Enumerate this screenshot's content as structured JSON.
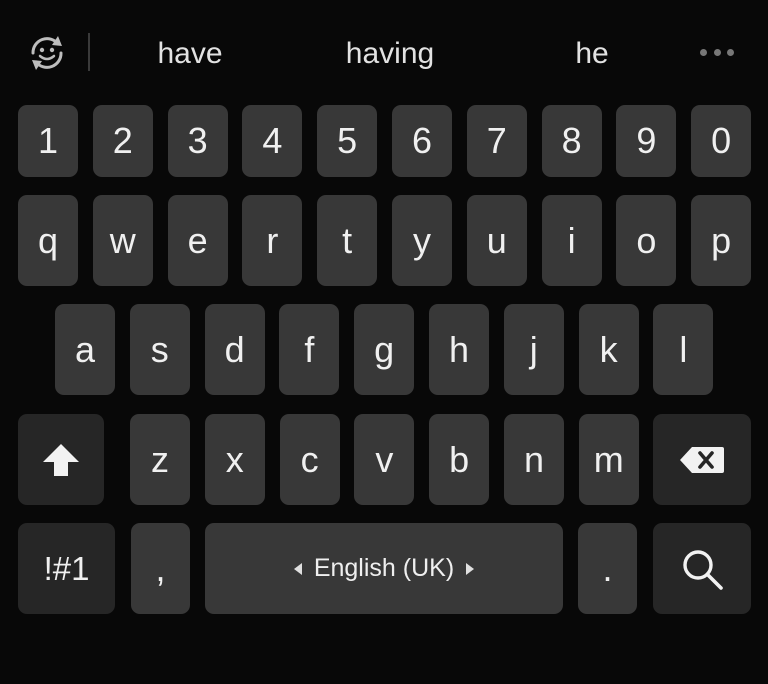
{
  "suggestions": [
    "have",
    "having",
    "he"
  ],
  "icons": {
    "emoji": "emoji-refresh-icon",
    "more": "more-horizontal-icon",
    "shift": "shift-arrow-icon",
    "backspace": "backspace-icon",
    "search": "search-icon",
    "lang_prev": "triangle-left-icon",
    "lang_next": "triangle-right-icon"
  },
  "rows": {
    "numbers": [
      "1",
      "2",
      "3",
      "4",
      "5",
      "6",
      "7",
      "8",
      "9",
      "0"
    ],
    "top": [
      "q",
      "w",
      "e",
      "r",
      "t",
      "y",
      "u",
      "i",
      "o",
      "p"
    ],
    "middle": [
      "a",
      "s",
      "d",
      "f",
      "g",
      "h",
      "j",
      "k",
      "l"
    ],
    "bottom": [
      "z",
      "x",
      "c",
      "v",
      "b",
      "n",
      "m"
    ]
  },
  "bottom_bar": {
    "symbols_label": "!#1",
    "comma_label": ",",
    "space_label": "English (UK)",
    "period_label": "."
  },
  "colors": {
    "background": "#080808",
    "key": "#383838",
    "function_key": "#262626",
    "text": "#f0f0f0"
  }
}
